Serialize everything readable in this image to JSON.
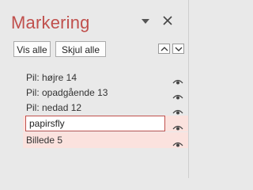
{
  "pane": {
    "title": "Markering",
    "show_all_label": "Vis alle",
    "hide_all_label": "Skjul alle"
  },
  "items": [
    {
      "label": "Pil: højre 14"
    },
    {
      "label": "Pil: opadgående 13"
    },
    {
      "label": "Pil: nedad 12"
    },
    {
      "label": "papirsfly"
    },
    {
      "label": "Billede 5"
    }
  ],
  "colors": {
    "accent": "#c0504d",
    "selection": "#fbe2de",
    "background": "#e9e9e9"
  }
}
